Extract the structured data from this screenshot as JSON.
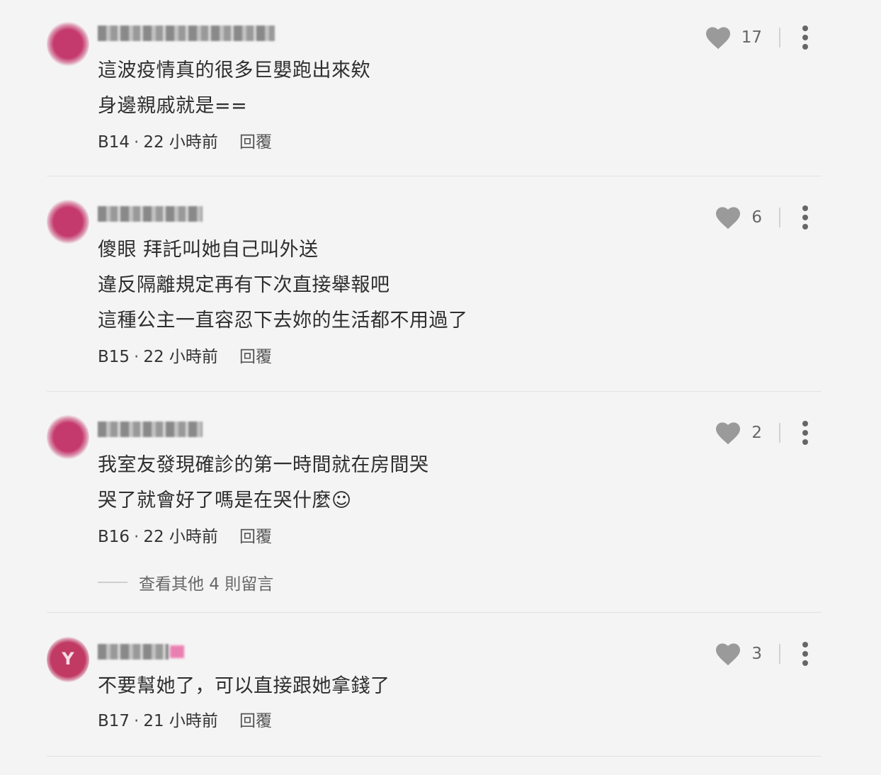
{
  "comments": [
    {
      "lines": [
        "這波疫情真的很多巨嬰跑出來欸",
        "身邊親戚就是=="
      ],
      "floor": "B14",
      "time": "22 小時前",
      "reply_label": "回覆",
      "likes": "17"
    },
    {
      "lines": [
        "傻眼 拜託叫她自己叫外送",
        "違反隔離規定再有下次直接舉報吧",
        "這種公主一直容忍下去妳的生活都不用過了"
      ],
      "floor": "B15",
      "time": "22 小時前",
      "reply_label": "回覆",
      "likes": "6"
    },
    {
      "lines": [
        "我室友發現確診的第一時間就在房間哭",
        "哭了就會好了嗎是在哭什麼☺"
      ],
      "floor": "B16",
      "time": "22 小時前",
      "reply_label": "回覆",
      "likes": "2",
      "view_more": "查看其他 4 則留言"
    },
    {
      "lines": [
        "不要幫她了，可以直接跟她拿錢了"
      ],
      "floor": "B17",
      "time": "21 小時前",
      "reply_label": "回覆",
      "likes": "3"
    }
  ],
  "icons": {
    "like": "heart-icon",
    "more": "more-vertical-icon"
  },
  "colors": {
    "background": "#f4f4f4",
    "avatar": "#c43a6c",
    "heart": "#9a9a9a"
  }
}
